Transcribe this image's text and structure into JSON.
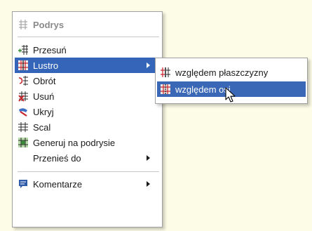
{
  "main_menu": {
    "header": {
      "label": "Podrys",
      "icon": "grid-icon"
    },
    "items": [
      {
        "label": "Przesuń",
        "icon": "move-grid-icon"
      },
      {
        "label": "Lustro",
        "icon": "mirror-grid-icon",
        "has_submenu": true,
        "highlighted": true
      },
      {
        "label": "Obrót",
        "icon": "rotate-grid-icon"
      },
      {
        "label": "Usuń",
        "icon": "delete-grid-icon"
      },
      {
        "label": "Ukryj",
        "icon": "hide-icon"
      },
      {
        "label": "Scal",
        "icon": "merge-grid-icon"
      },
      {
        "label": "Generuj na podrysie",
        "icon": "generate-grid-icon"
      },
      {
        "label": "Przenieś do",
        "has_submenu": true
      },
      {
        "label": "Komentarze",
        "icon": "comment-icon",
        "has_submenu": true
      }
    ]
  },
  "sub_menu": {
    "items": [
      {
        "label": "względem płaszczyzny",
        "icon": "mirror-plane-icon"
      },
      {
        "label": "względem osi",
        "icon": "mirror-axis-icon",
        "highlighted": true
      }
    ]
  },
  "colors": {
    "highlight": "#3565b9",
    "background": "#fdfce6",
    "accent_red": "#c8242b",
    "accent_green": "#3a8a3a"
  }
}
